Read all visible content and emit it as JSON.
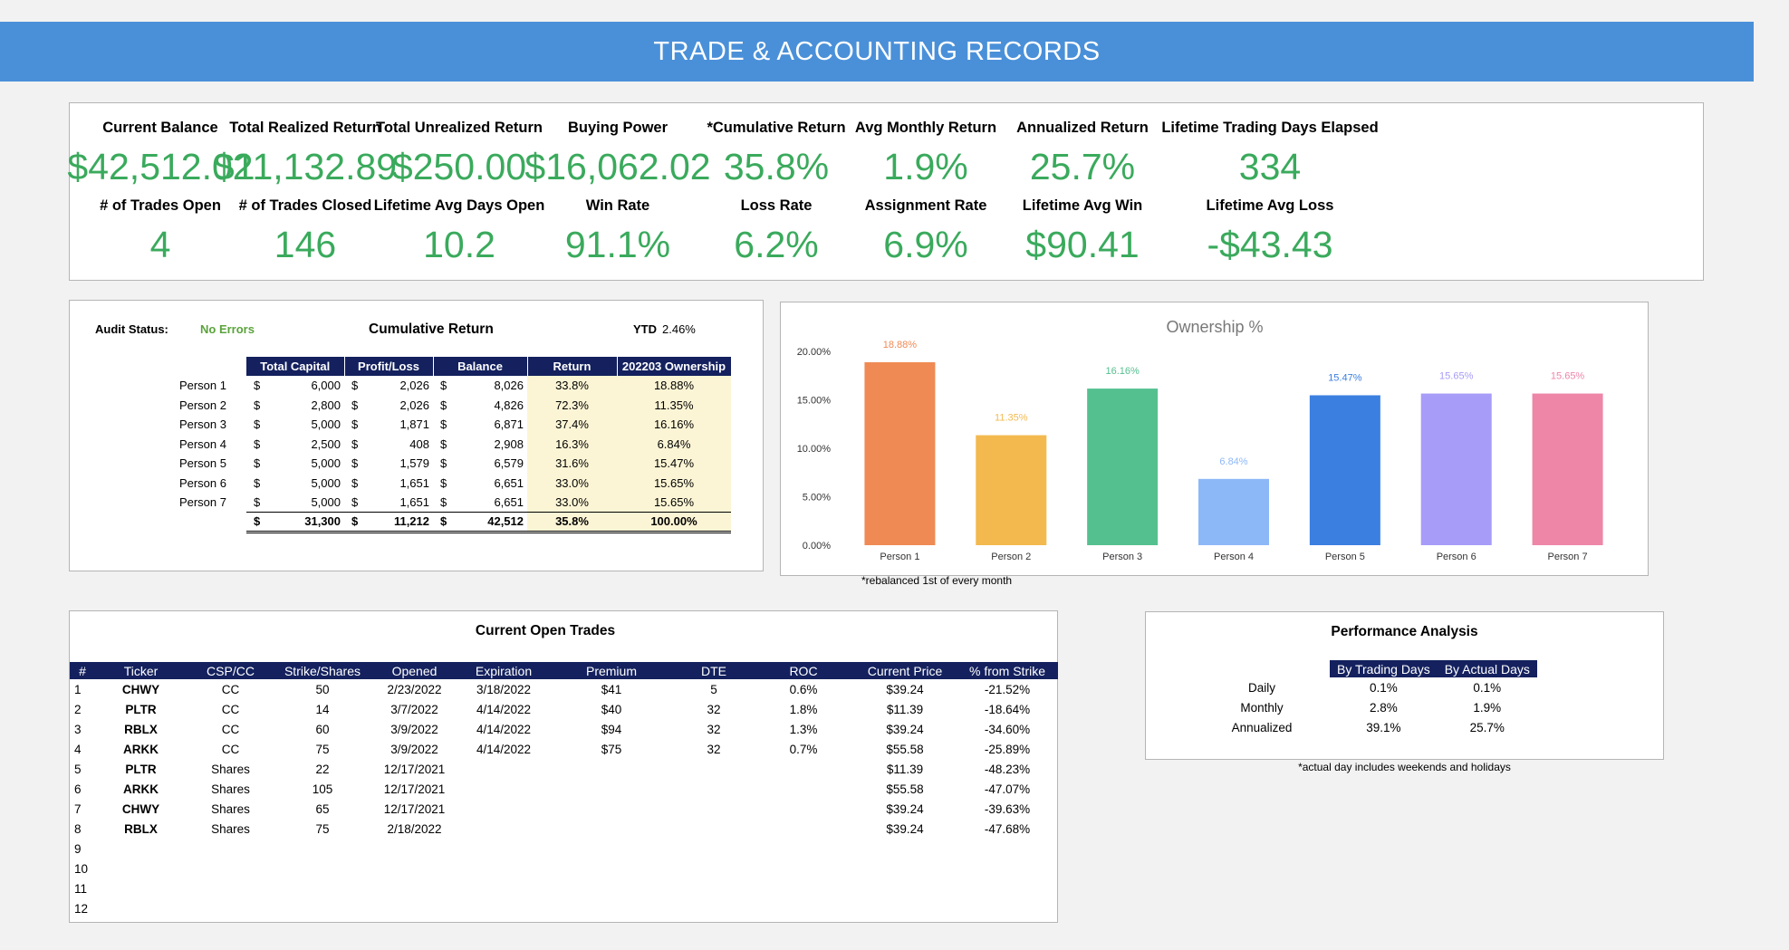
{
  "header": {
    "title": "TRADE & ACCOUNTING RECORDS"
  },
  "kpi": [
    {
      "label": "Current Balance",
      "value": "$42,512.02"
    },
    {
      "label": "Total Realized Return",
      "value": "$11,132.89"
    },
    {
      "label": "Total Unrealized Return",
      "value": "$250.00"
    },
    {
      "label": "Buying Power",
      "value": "$16,062.02"
    },
    {
      "label": "*Cumulative Return",
      "value": "35.8%"
    },
    {
      "label": "Avg Monthly Return",
      "value": "1.9%"
    },
    {
      "label": "Annualized Return",
      "value": "25.7%"
    },
    {
      "label": "Lifetime Trading Days Elapsed",
      "value": "334"
    },
    {
      "label": "# of Trades Open",
      "value": "4"
    },
    {
      "label": "# of Trades Closed",
      "value": "146"
    },
    {
      "label": "Lifetime Avg Days Open",
      "value": "10.2"
    },
    {
      "label": "Win Rate",
      "value": "91.1%"
    },
    {
      "label": "Loss Rate",
      "value": "6.2%"
    },
    {
      "label": "Assignment Rate",
      "value": "6.9%"
    },
    {
      "label": "Lifetime Avg Win",
      "value": "$90.41"
    },
    {
      "label": "Lifetime Avg Loss",
      "value": "-$43.43"
    }
  ],
  "cumulative": {
    "audit_label": "Audit Status:",
    "audit_value": "No Errors",
    "title": "Cumulative Return",
    "ytd_label": "YTD",
    "ytd_value": "2.46%",
    "headers": [
      "Total Capital",
      "Profit/Loss",
      "Balance",
      "Return",
      "202203 Ownership"
    ],
    "currency": "$",
    "rows": [
      {
        "name": "Person 1",
        "capital": "6,000",
        "pl": "2,026",
        "balance": "8,026",
        "ret": "33.8%",
        "own": "18.88%"
      },
      {
        "name": "Person 2",
        "capital": "2,800",
        "pl": "2,026",
        "balance": "4,826",
        "ret": "72.3%",
        "own": "11.35%"
      },
      {
        "name": "Person 3",
        "capital": "5,000",
        "pl": "1,871",
        "balance": "6,871",
        "ret": "37.4%",
        "own": "16.16%"
      },
      {
        "name": "Person 4",
        "capital": "2,500",
        "pl": "408",
        "balance": "2,908",
        "ret": "16.3%",
        "own": "6.84%"
      },
      {
        "name": "Person 5",
        "capital": "5,000",
        "pl": "1,579",
        "balance": "6,579",
        "ret": "31.6%",
        "own": "15.47%"
      },
      {
        "name": "Person 6",
        "capital": "5,000",
        "pl": "1,651",
        "balance": "6,651",
        "ret": "33.0%",
        "own": "15.65%"
      },
      {
        "name": "Person 7",
        "capital": "5,000",
        "pl": "1,651",
        "balance": "6,651",
        "ret": "33.0%",
        "own": "15.65%"
      }
    ],
    "total": {
      "capital": "31,300",
      "pl": "11,212",
      "balance": "42,512",
      "ret": "35.8%",
      "own": "100.00%"
    }
  },
  "chart_data": {
    "type": "bar",
    "title": "Ownership %",
    "categories": [
      "Person 1",
      "Person 2",
      "Person 3",
      "Person 4",
      "Person 5",
      "Person 6",
      "Person 7"
    ],
    "values": [
      18.88,
      11.35,
      16.16,
      6.84,
      15.47,
      15.65,
      15.65
    ],
    "value_labels": [
      "18.88%",
      "11.35%",
      "16.16%",
      "6.84%",
      "15.47%",
      "15.65%",
      "15.65%"
    ],
    "colors": [
      "#ef8a54",
      "#f3b94f",
      "#55c08f",
      "#8db8f7",
      "#3b7fe0",
      "#a79cf7",
      "#ee86a8"
    ],
    "label_colors": [
      "#ef8a54",
      "#f3b94f",
      "#55c08f",
      "#8db8f7",
      "#3b7fe0",
      "#a79cf7",
      "#ee86a8"
    ],
    "yticks": [
      "0.00%",
      "5.00%",
      "10.00%",
      "15.00%",
      "20.00%"
    ],
    "ylim": [
      0,
      20
    ],
    "xlabel": "",
    "ylabel": "",
    "grid": false,
    "note": "*rebalanced 1st of every month"
  },
  "trades": {
    "title": "Current Open Trades",
    "headers": [
      "#",
      "Ticker",
      "CSP/CC",
      "Strike/Shares",
      "Opened",
      "Expiration",
      "Premium",
      "DTE",
      "ROC",
      "Current Price",
      "% from Strike"
    ],
    "rows": [
      [
        "1",
        "CHWY",
        "CC",
        "50",
        "2/23/2022",
        "3/18/2022",
        "$41",
        "5",
        "0.6%",
        "$39.24",
        "-21.52%"
      ],
      [
        "2",
        "PLTR",
        "CC",
        "14",
        "3/7/2022",
        "4/14/2022",
        "$40",
        "32",
        "1.8%",
        "$11.39",
        "-18.64%"
      ],
      [
        "3",
        "RBLX",
        "CC",
        "60",
        "3/9/2022",
        "4/14/2022",
        "$94",
        "32",
        "1.3%",
        "$39.24",
        "-34.60%"
      ],
      [
        "4",
        "ARKK",
        "CC",
        "75",
        "3/9/2022",
        "4/14/2022",
        "$75",
        "32",
        "0.7%",
        "$55.58",
        "-25.89%"
      ],
      [
        "5",
        "PLTR",
        "Shares",
        "22",
        "12/17/2021",
        "",
        "",
        "",
        "",
        "$11.39",
        "-48.23%"
      ],
      [
        "6",
        "ARKK",
        "Shares",
        "105",
        "12/17/2021",
        "",
        "",
        "",
        "",
        "$55.58",
        "-47.07%"
      ],
      [
        "7",
        "CHWY",
        "Shares",
        "65",
        "12/17/2021",
        "",
        "",
        "",
        "",
        "$39.24",
        "-39.63%"
      ],
      [
        "8",
        "RBLX",
        "Shares",
        "75",
        "2/18/2022",
        "",
        "",
        "",
        "",
        "$39.24",
        "-47.68%"
      ],
      [
        "9",
        "",
        "",
        "",
        "",
        "",
        "",
        "",
        "",
        "",
        ""
      ],
      [
        "10",
        "",
        "",
        "",
        "",
        "",
        "",
        "",
        "",
        "",
        ""
      ],
      [
        "11",
        "",
        "",
        "",
        "",
        "",
        "",
        "",
        "",
        "",
        ""
      ],
      [
        "12",
        "",
        "",
        "",
        "",
        "",
        "",
        "",
        "",
        "",
        ""
      ]
    ]
  },
  "performance": {
    "title": "Performance Analysis",
    "headers": [
      "By Trading Days",
      "By Actual Days"
    ],
    "rows": [
      {
        "label": "Daily",
        "trading": "0.1%",
        "actual": "0.1%"
      },
      {
        "label": "Monthly",
        "trading": "2.8%",
        "actual": "1.9%"
      },
      {
        "label": "Annualized",
        "trading": "39.1%",
        "actual": "25.7%"
      }
    ],
    "note": "*actual day includes weekends and holidays"
  }
}
